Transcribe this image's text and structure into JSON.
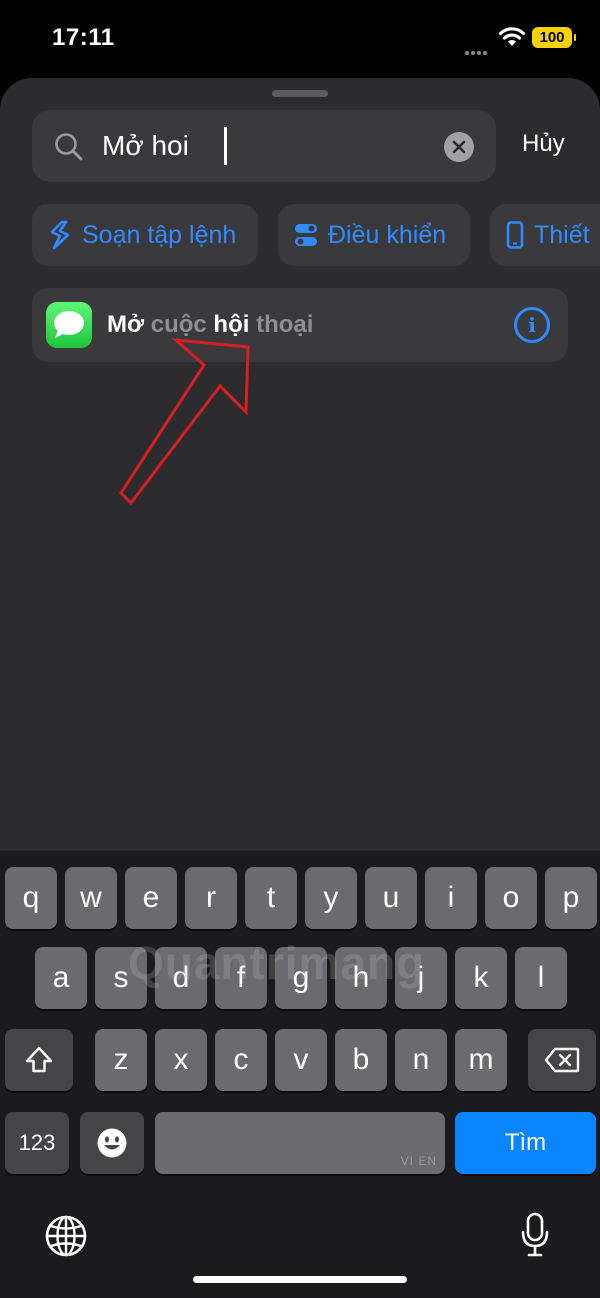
{
  "status_bar": {
    "time": "17:11",
    "battery": "100"
  },
  "search": {
    "value": "Mở hoi",
    "cancel_label": "Hủy"
  },
  "chips": [
    {
      "label": "Soạn tập lệnh",
      "icon": "script-icon"
    },
    {
      "label": "Điều khiển",
      "icon": "toggles-icon"
    },
    {
      "label": "Thiết",
      "icon": "phone-icon"
    }
  ],
  "result": {
    "title_parts": [
      "Mở",
      " cuộc ",
      "hội",
      " thoại"
    ],
    "icon": "messages-app-icon"
  },
  "keyboard": {
    "row1": [
      "q",
      "w",
      "e",
      "r",
      "t",
      "y",
      "u",
      "i",
      "o",
      "p"
    ],
    "row2": [
      "a",
      "s",
      "d",
      "f",
      "g",
      "h",
      "j",
      "k",
      "l"
    ],
    "row3": [
      "z",
      "x",
      "c",
      "v",
      "b",
      "n",
      "m"
    ],
    "numbers_label": "123",
    "languages": "VI EN",
    "return_label": "Tìm"
  },
  "watermark": "Quantrimang",
  "colors": {
    "accent": "#0a84ff",
    "sheet": "#2c2c2e",
    "field": "#3a3a3c",
    "annotation": "#d81f1f"
  }
}
